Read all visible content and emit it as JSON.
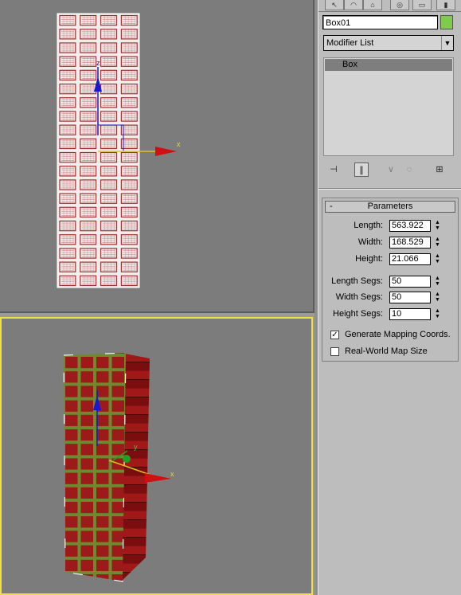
{
  "panel": {
    "tabs": [
      "create",
      "modify",
      "hierarchy",
      "motion",
      "display",
      "utilities"
    ],
    "object_name": "Box01",
    "object_color": "#7ecb4d",
    "modifier_list": {
      "selected": "Modifier List"
    },
    "stack": {
      "items": [
        "Box"
      ]
    },
    "toolbar_icons": [
      "pin-stack-icon",
      "show-end-result-icon",
      "make-unique-icon",
      "remove-modifier-icon",
      "configure-modifier-sets-icon"
    ],
    "parameters": {
      "title": "Parameters",
      "collapse_symbol": "-",
      "length_label": "Length:",
      "length": "563.922",
      "width_label": "Width:",
      "width": "168.529",
      "height_label": "Height:",
      "height": "21.066",
      "length_segs_label": "Length Segs:",
      "length_segs": "50",
      "width_segs_label": "Width Segs:",
      "width_segs": "50",
      "height_segs_label": "Height Segs:",
      "height_segs": "10",
      "gen_mapping_label": "Generate Mapping Coords.",
      "gen_mapping_checked": true,
      "real_world_label": "Real-World Map Size",
      "real_world_checked": false
    }
  },
  "viewports": {
    "top": {
      "axis_x": "x",
      "axis_z": "z"
    },
    "perspective": {
      "axis_x": "x",
      "axis_y": "y"
    }
  },
  "colors": {
    "active_viewport_border": "#f0e040",
    "wire_red": "#8a1010",
    "grid_green": "#6a8a2a"
  }
}
